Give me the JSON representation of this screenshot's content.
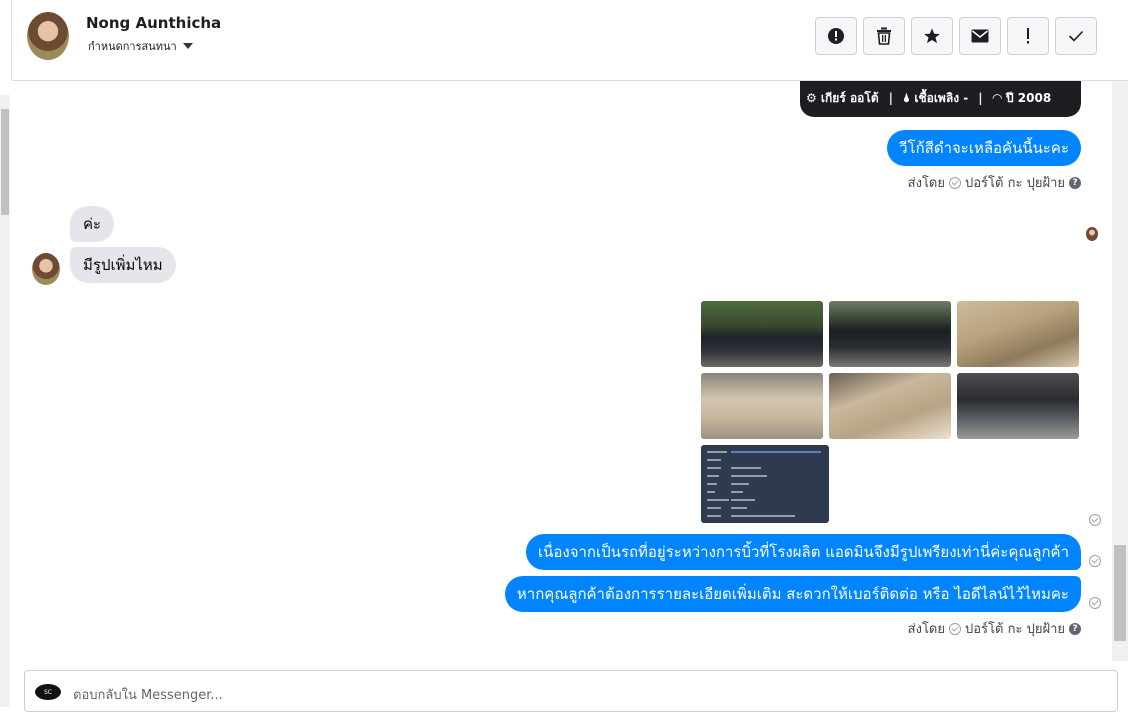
{
  "header": {
    "name": "Nong Aunthicha",
    "subtitle": "กำหนดการสนทนา",
    "actions": [
      {
        "icon": "alert-circle-icon"
      },
      {
        "icon": "trash-icon"
      },
      {
        "icon": "star-icon"
      },
      {
        "icon": "envelope-icon"
      },
      {
        "icon": "exclamation-icon"
      },
      {
        "icon": "check-icon"
      }
    ]
  },
  "card": {
    "gear": "⚙ เกียร์ ออโต้",
    "fuel": "🌢 เชื้อเพลิง -",
    "year": "◠ ปี 2008"
  },
  "messages": {
    "out1": "วีโก้สีดำจะเหลือคันนี้นะคะ",
    "sent_by_prefix": "ส่งโดย",
    "sent_by_name": "ปอร์โต้ กะ ปุยฝ้าย",
    "in1": "ค่ะ",
    "in2": "มีรูปเพิ่มไหม",
    "out2": "เนื่องจากเป็นรถที่อยู่ระหว่างการบิ้วที่โรงผลิต แอดมินจึงมีรูปเพรียงเท่านี่ค่ะคุณลูกค้า",
    "out3": "หากคุณลูกค้าต้องการรายละเอียดเพิ่มเติม สะดวกให้เบอร์ติดต่อ หรือ ไอดีไลน์ไว้ไหมคะ"
  },
  "reply": {
    "placeholder": "ตอบกลับใน Messenger..."
  }
}
